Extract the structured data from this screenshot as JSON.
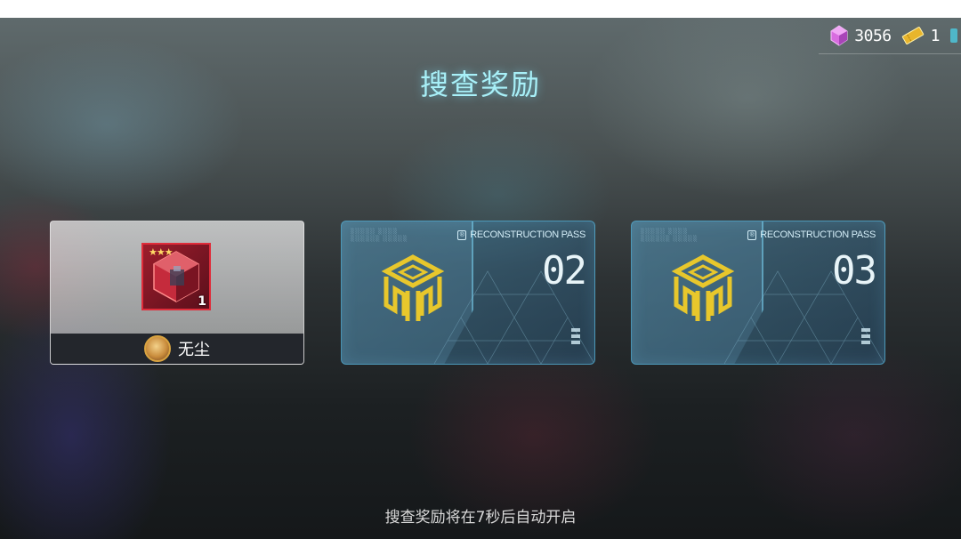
{
  "header": {
    "title": "搜查奖励"
  },
  "currencies": [
    {
      "name": "crystal",
      "icon": "pink-crystal-icon",
      "value": "3056"
    },
    {
      "name": "ticket",
      "icon": "gold-ticket-icon",
      "value": "1"
    }
  ],
  "rewards": {
    "revealed": {
      "item_icon": "red-cube-item-icon",
      "stars": "★★★",
      "count": "1",
      "character_name": "无尘"
    },
    "sealed": [
      {
        "pass_label": "RECONSTRUCTION PASS",
        "number": "02"
      },
      {
        "pass_label": "RECONSTRUCTION PASS",
        "number": "03"
      }
    ]
  },
  "footer": {
    "hint": "搜查奖励将在7秒后自动开启"
  },
  "colors": {
    "title": "#a8f0f8",
    "card_border": "#5abee6",
    "cube_gold": "#e8c72c",
    "item_frame": "#e02c3a"
  }
}
